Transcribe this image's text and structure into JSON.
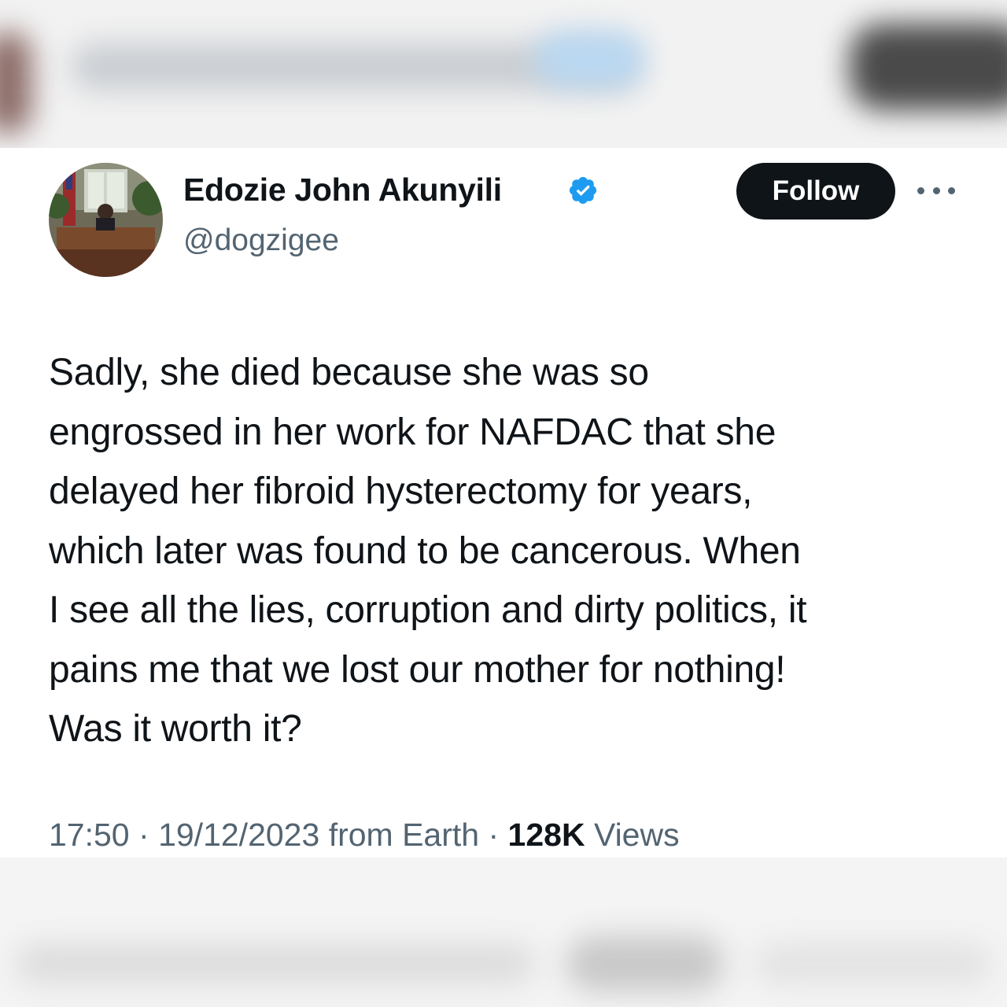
{
  "tweet": {
    "author": {
      "display_name": "Edozie John Akunyili",
      "handle": "@dogzigee",
      "verified": true,
      "verified_icon": "verified-badge-icon"
    },
    "follow_label": "Follow",
    "more_icon": "more-horizontal-icon",
    "text_lines": [
      "Sadly, she died because she was so",
      "engrossed in her work for NAFDAC that she",
      "delayed her fibroid hysterectomy for years,",
      "which later was found to be cancerous. When",
      "I see all the lies, corruption and dirty politics, it",
      "pains me that we lost our mother for nothing!",
      "Was it worth it?"
    ],
    "meta": {
      "time": "17:50",
      "separator": "·",
      "date": "19/12/2023",
      "source": "from Earth",
      "views_count": "128K",
      "views_label": "Views"
    }
  },
  "colors": {
    "text_primary": "#0f1419",
    "text_secondary": "#536471",
    "verified_blue": "#1d9bf0",
    "follow_bg": "#0f1419"
  }
}
